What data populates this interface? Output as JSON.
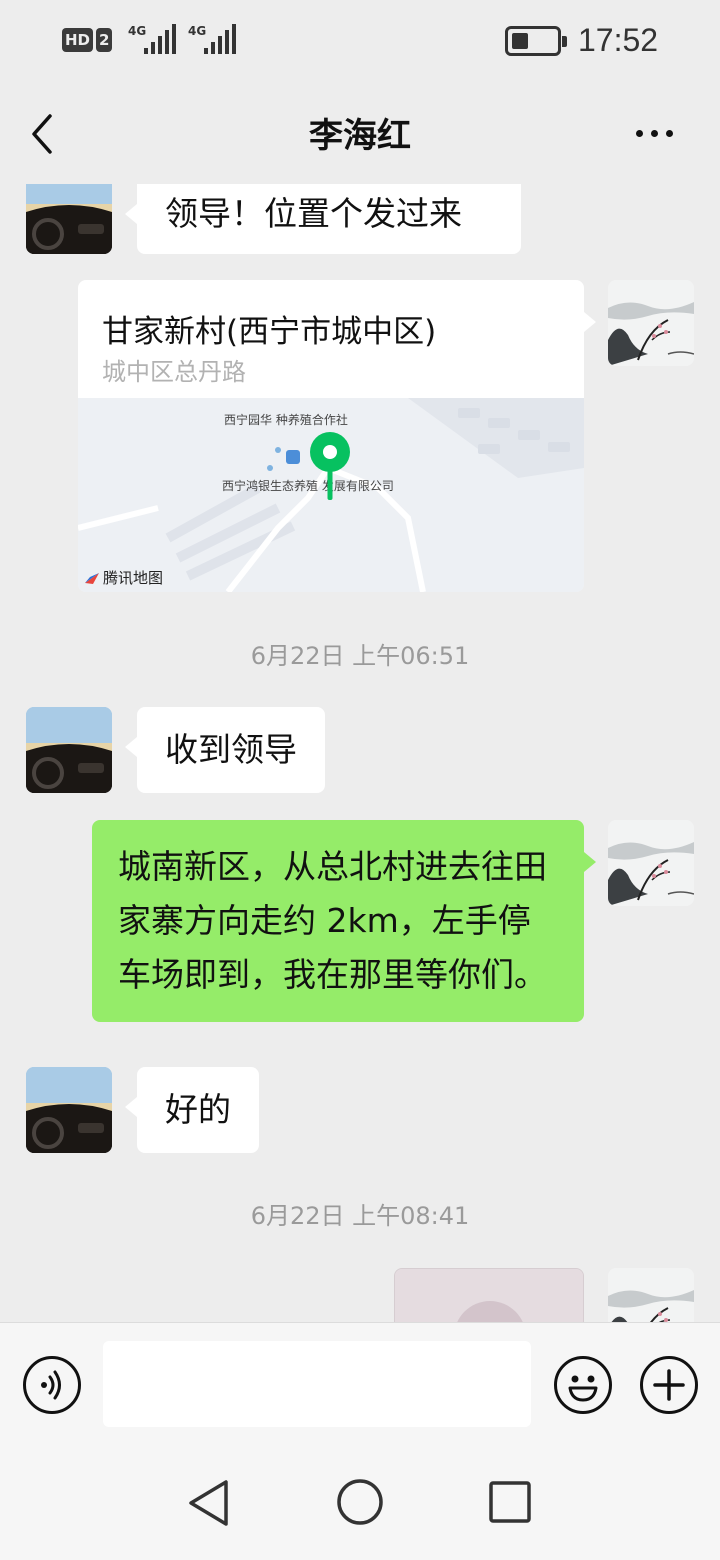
{
  "status_bar": {
    "hd_label": "HD",
    "sim_label": "2",
    "signal1_label": "4G",
    "signal2_label": "4G",
    "time": "17:52"
  },
  "header": {
    "title": "李海红",
    "back_icon": "chevron-left-icon",
    "more_icon": "more-dots-icon"
  },
  "messages": {
    "msg1_text": "领导！位置个发过来",
    "location": {
      "title": "甘家新村(西宁市城中区)",
      "subtitle": "城中区总丹路",
      "map_label_1": "西宁园华 种养殖合作社",
      "map_label_2": "西宁鸿银生态养殖 发展有限公司",
      "map_brand": "腾讯地图"
    },
    "timestamp1": "6月22日 上午06:51",
    "msg2_text": "收到领导",
    "msg3_text": "城南新区，从总北村进去往田家寨方向走约 2km，左手停车场即到，我在那里等你们。",
    "msg4_text": "好的",
    "timestamp2": "6月22日 上午08:41"
  },
  "input_bar": {
    "voice_icon": "voice-icon",
    "text_value": "",
    "emoji_icon": "emoji-icon",
    "plus_icon": "plus-icon"
  },
  "system_nav": {
    "back_icon": "triangle-back-icon",
    "home_icon": "circle-home-icon",
    "recents_icon": "square-recents-icon"
  },
  "colors": {
    "background": "#ededed",
    "sent_bubble": "#95ec69",
    "received_bubble": "#ffffff",
    "map_pin": "#07c160"
  }
}
